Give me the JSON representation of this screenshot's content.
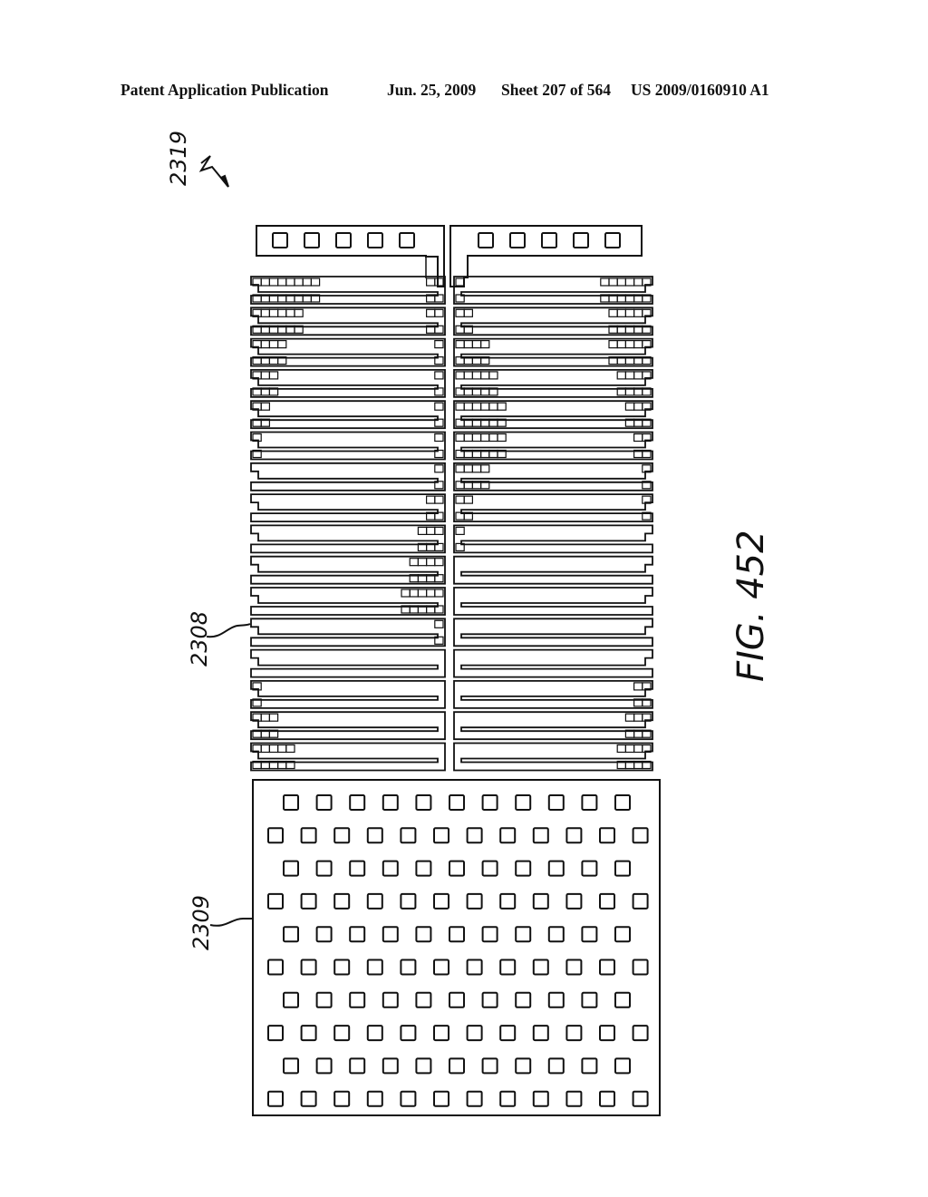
{
  "header": {
    "publication": "Patent Application Publication",
    "date": "Jun. 25, 2009",
    "sheet": "Sheet 207 of 564",
    "number": "US 2009/0160910 A1"
  },
  "figure": {
    "label": "FIG. 452",
    "references": {
      "assembly": "2319",
      "heater_array": "2308",
      "nozzle_plate": "2309"
    },
    "contact_pads_per_side": 5,
    "serpentine_rows_per_side": 16,
    "nozzle_grid": {
      "rows": 10,
      "columns_long_row": 12,
      "columns_short_row": 11
    }
  },
  "colors": {
    "ink": "#111111",
    "paper": "#ffffff"
  }
}
